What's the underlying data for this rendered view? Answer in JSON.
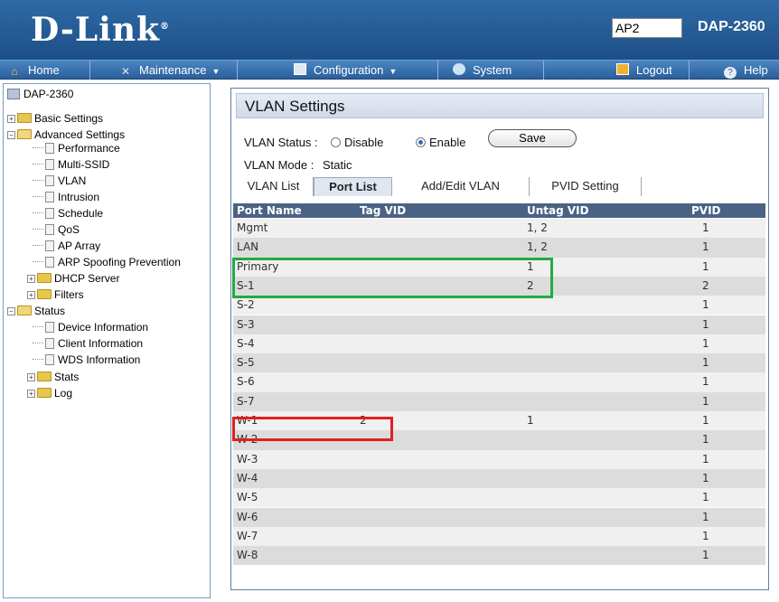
{
  "header": {
    "logo": "D-Link",
    "logo_mark": "®",
    "ap_name": "AP2",
    "model": "DAP-2360"
  },
  "menubar": {
    "items": [
      {
        "label": "Home",
        "icon": "home-icon"
      },
      {
        "label": "Maintenance",
        "icon": "tools-icon"
      },
      {
        "label": "Configuration",
        "icon": "disk-icon"
      },
      {
        "label": "System",
        "icon": "system-icon"
      },
      {
        "label": "Logout",
        "icon": "key-icon"
      },
      {
        "label": "Help",
        "icon": "help-icon"
      }
    ]
  },
  "sidebar": {
    "root": "DAP-2360",
    "basic": "Basic Settings",
    "advanced": "Advanced Settings",
    "advanced_items": [
      "Performance",
      "Multi-SSID",
      "VLAN",
      "Intrusion",
      "Schedule",
      "QoS",
      "AP Array",
      "ARP Spoofing Prevention"
    ],
    "dhcp": "DHCP Server",
    "filters": "Filters",
    "status": "Status",
    "status_items": [
      "Device Information",
      "Client Information",
      "WDS Information"
    ],
    "stats": "Stats",
    "log": "Log"
  },
  "panel": {
    "title": "VLAN Settings",
    "vlan_status_label": "VLAN Status :",
    "disable_label": "Disable",
    "enable_label": "Enable",
    "vlan_status_value": "Enable",
    "save_label": "Save",
    "vlan_mode_label": "VLAN Mode :",
    "vlan_mode_value": "Static",
    "tabs": [
      "VLAN List",
      "Port List",
      "Add/Edit VLAN",
      "PVID Setting"
    ],
    "active_tab": "Port List"
  },
  "table": {
    "headers": [
      "Port Name",
      "Tag VID",
      "Untag VID",
      "PVID"
    ],
    "rows": [
      [
        "Mgmt",
        "",
        "1, 2",
        "1"
      ],
      [
        "LAN",
        "",
        "1, 2",
        "1"
      ],
      [
        "Primary",
        "",
        "1",
        "1"
      ],
      [
        "S-1",
        "",
        "2",
        "2"
      ],
      [
        "S-2",
        "",
        "",
        "1"
      ],
      [
        "S-3",
        "",
        "",
        "1"
      ],
      [
        "S-4",
        "",
        "",
        "1"
      ],
      [
        "S-5",
        "",
        "",
        "1"
      ],
      [
        "S-6",
        "",
        "",
        "1"
      ],
      [
        "S-7",
        "",
        "",
        "1"
      ],
      [
        "W-1",
        "2",
        "1",
        "1"
      ],
      [
        "W-2",
        "",
        "",
        "1"
      ],
      [
        "W-3",
        "",
        "",
        "1"
      ],
      [
        "W-4",
        "",
        "",
        "1"
      ],
      [
        "W-5",
        "",
        "",
        "1"
      ],
      [
        "W-6",
        "",
        "",
        "1"
      ],
      [
        "W-7",
        "",
        "",
        "1"
      ],
      [
        "W-8",
        "",
        "",
        "1"
      ]
    ]
  },
  "colors": {
    "header": "#1d4f87",
    "green_highlight": "#22aa44",
    "red_highlight": "#e02020"
  }
}
